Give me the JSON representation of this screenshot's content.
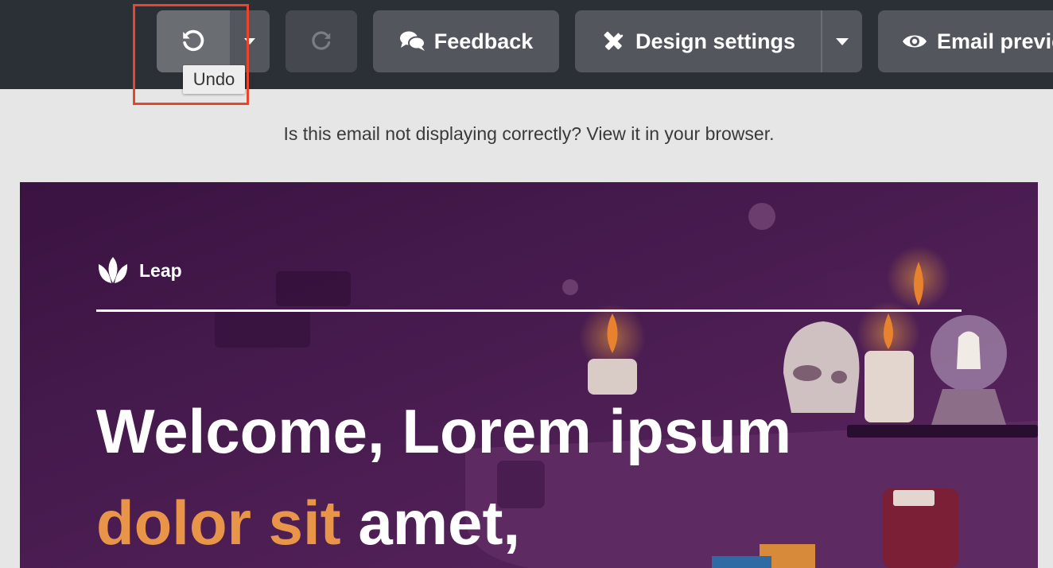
{
  "toolbar": {
    "undo_tooltip": "Undo",
    "feedback_label": "Feedback",
    "design_settings_label": "Design settings",
    "email_preview_label": "Email previe"
  },
  "notice": {
    "text": "Is this email not displaying correctly? View it in your browser."
  },
  "email": {
    "brand": "Leap",
    "headline_line1": "Welcome, Lorem ipsum",
    "headline_accent": "dolor sit",
    "headline_rest": "amet,"
  },
  "colors": {
    "toolbar_bg": "#2b2f36",
    "button_bg": "#53565c",
    "highlight": "#e8452c",
    "email_bg": "#3d1846",
    "accent": "#e8954a"
  }
}
